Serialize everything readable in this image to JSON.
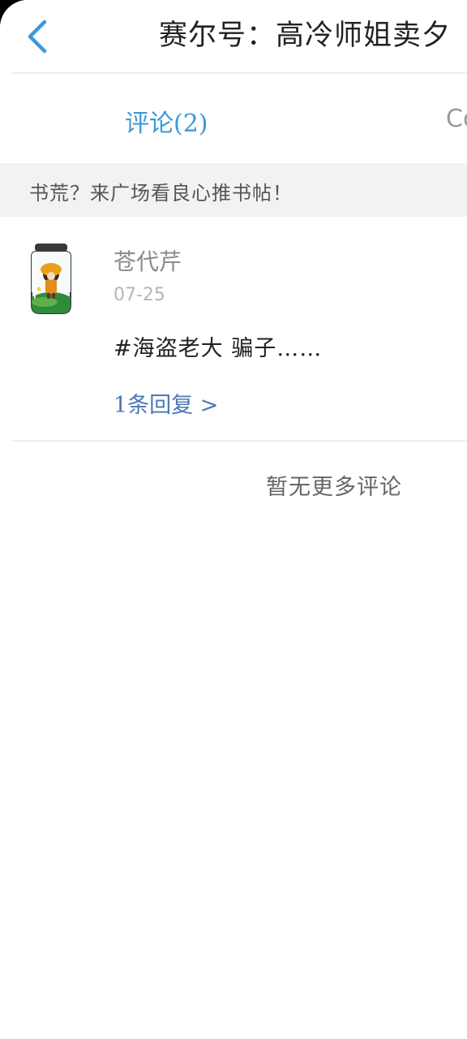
{
  "header": {
    "title": "赛尔号：高冷师姐卖夕",
    "back_icon": "chevron-left-icon",
    "accent_color": "#3a9ad9"
  },
  "tabs": [
    {
      "label": "评论(2)",
      "active": true
    },
    {
      "label": "Co",
      "active": false
    }
  ],
  "banner": {
    "text": "书荒？来广场看良心推书帖！"
  },
  "comments": [
    {
      "username": "苍代芹",
      "date": "07-25",
      "content": "#海盗老大 骗子……",
      "reply_link": "1条回复 >"
    }
  ],
  "footer": {
    "no_more_text": "暂无更多评论"
  }
}
